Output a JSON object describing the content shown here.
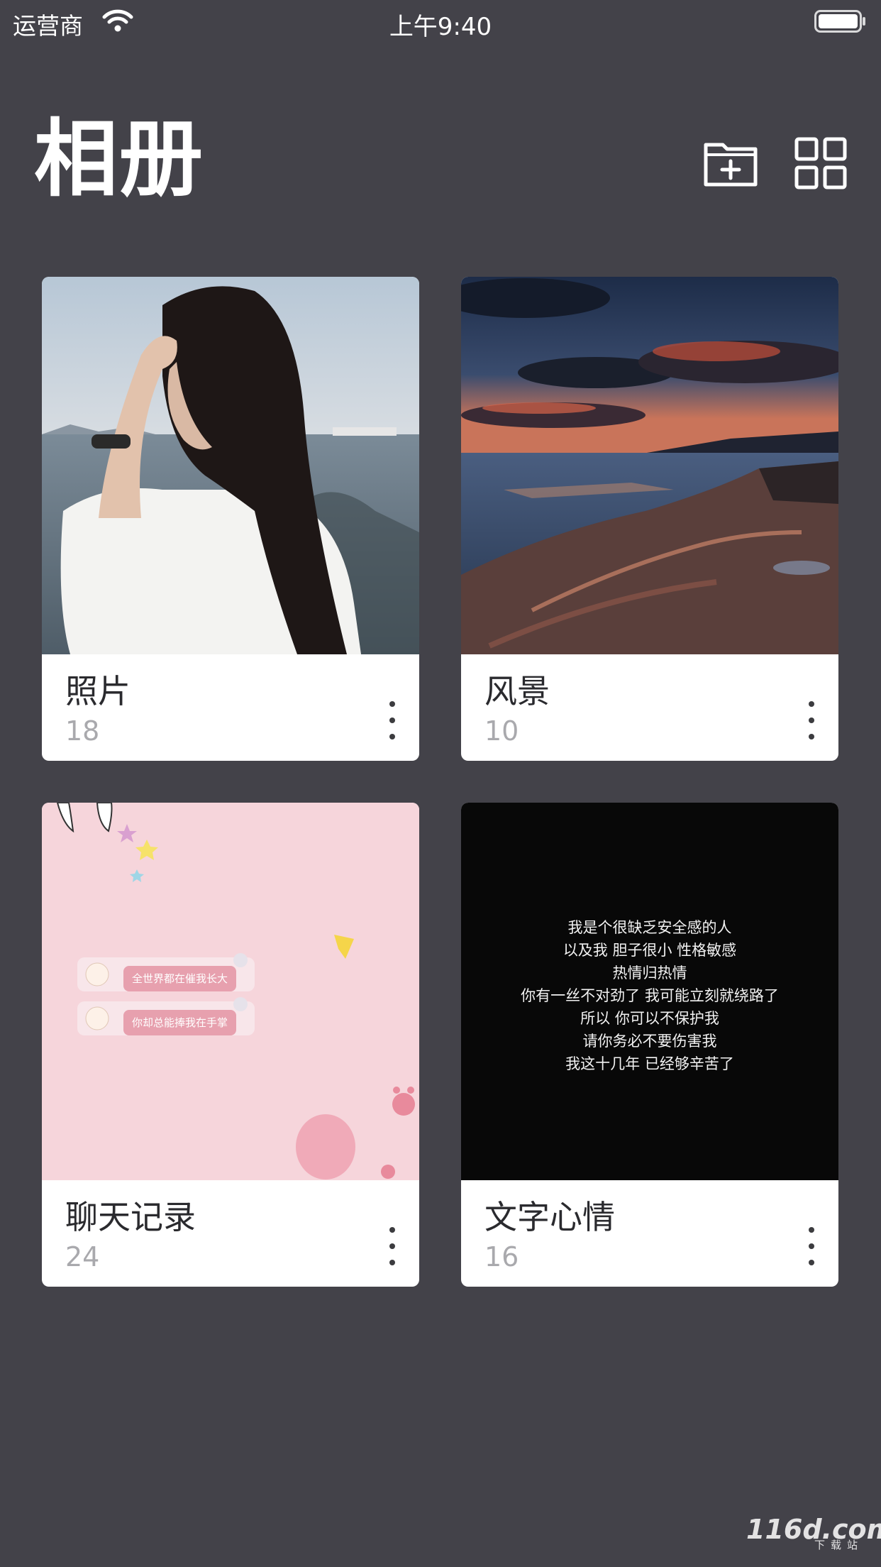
{
  "status_bar": {
    "carrier": "运营商",
    "time": "上午9:40"
  },
  "header": {
    "title": "相册",
    "new_album_icon": "folder-plus-icon",
    "grid_icon": "grid-view-icon"
  },
  "albums": [
    {
      "name": "照片",
      "count": "18",
      "thumbnail": "girl-by-sea-photo"
    },
    {
      "name": "风景",
      "count": "10",
      "thumbnail": "seaside-sunset-photo"
    },
    {
      "name": "聊天记录",
      "count": "24",
      "thumbnail": "pink-chat-screenshot",
      "chat_lines": [
        "全世界都在催我长大",
        "你却总能捧我在手掌"
      ]
    },
    {
      "name": "文字心情",
      "count": "16",
      "thumbnail": "text-mood-image",
      "mood_lines": [
        "我是个很缺乏安全感的人",
        "以及我 胆子很小 性格敏感",
        "热情归热情",
        "你有一丝不对劲了 我可能立刻就绕路了",
        "所以 你可以不保护我",
        "请你务必不要伤害我",
        "我这十几年 已经够辛苦了"
      ]
    }
  ],
  "watermark": {
    "brand": "116d.com",
    "sub": "下载站"
  },
  "colors": {
    "background": "#434249",
    "card": "#ffffff",
    "album_name": "#2a2a2e",
    "album_count": "#a9a9ad"
  }
}
